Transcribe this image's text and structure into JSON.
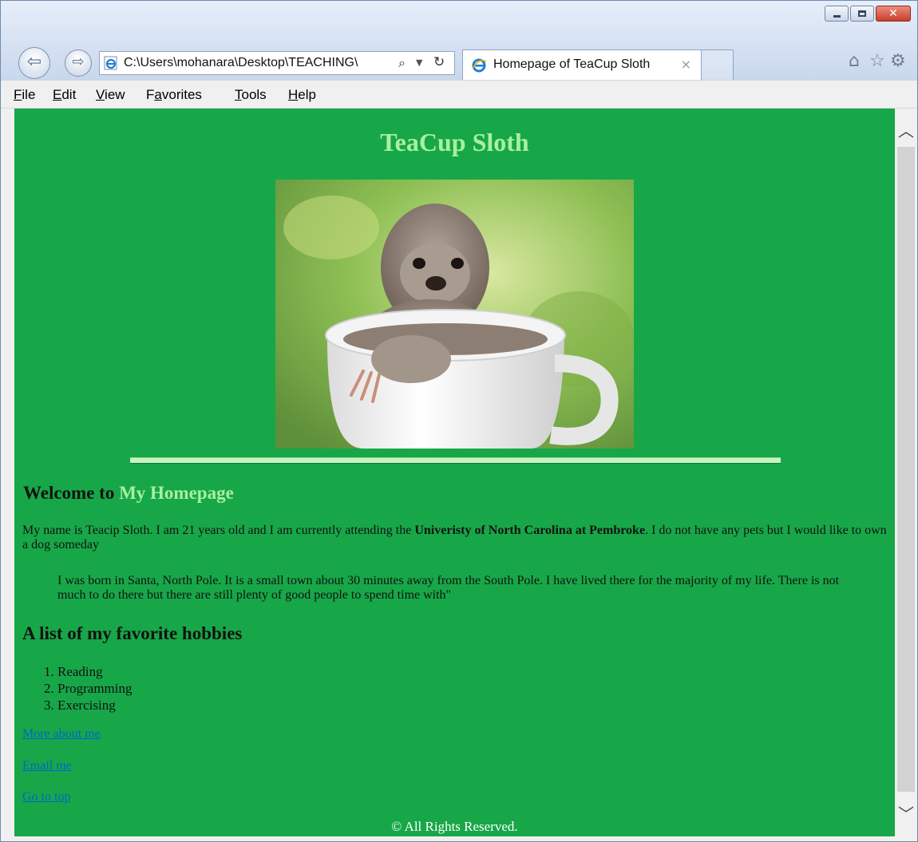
{
  "browser": {
    "address": "C:\\Users\\mohanara\\Desktop\\TEACHING\\",
    "tab_title": "Homepage of TeaCup Sloth",
    "tab_close": "×",
    "menu": [
      {
        "label_accel": "F",
        "label_rest": "ile"
      },
      {
        "label_accel": "E",
        "label_rest": "dit"
      },
      {
        "label_accel": "V",
        "label_rest": "iew"
      },
      {
        "label_pre": "F",
        "label_accel": "a",
        "label_rest": "vorites"
      },
      {
        "label_accel": "T",
        "label_rest": "ools"
      },
      {
        "label_accel": "H",
        "label_rest": "elp"
      }
    ]
  },
  "page": {
    "title": "TeaCup Sloth",
    "welcome_prefix": "Welcome to ",
    "welcome_highlight": "My Homepage",
    "intro_text": "My name is Teacip Sloth. I am 21 years old and I am currently attending the ",
    "intro_bold": "Univeristy of North Carolina at Pembroke",
    "intro_tail": ". I do not have any pets but I would like to own a dog someday",
    "quote": "I was born in Santa, North Pole. It is a small town about 30 minutes away from the South Pole. I have lived there for the majority of my life. There is not much to do there but there are still plenty of good people to spend time with\"",
    "hobbies_heading": "A list of my favorite hobbies",
    "hobbies": [
      "Reading",
      "Programming",
      "Exercising"
    ],
    "links": [
      "More about me",
      "Email me",
      "Go to top"
    ],
    "footer": "©   All Rights Reserved."
  },
  "colors": {
    "page_background": "#17a748",
    "title_color": "#a8f0a0",
    "link_color": "#0066cc"
  }
}
